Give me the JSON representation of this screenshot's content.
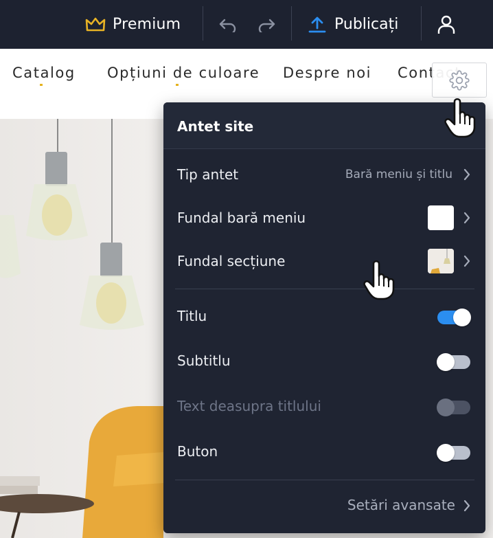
{
  "topbar": {
    "premium_label": "Premium",
    "publish_label": "Publicați",
    "icons": [
      "crown-icon",
      "undo-icon",
      "redo-icon",
      "upload-icon",
      "user-icon"
    ],
    "colors": {
      "background": "#1d2230",
      "crown": "#e8b325",
      "publish_icon": "#2b8ef0"
    }
  },
  "nav": {
    "items": [
      "Catalog",
      "Opțiuni de culoare",
      "Despre noi",
      "Contact"
    ],
    "settings_icon": "gear-icon"
  },
  "panel": {
    "title": "Antet site",
    "rows": {
      "header_type": {
        "label": "Tip antet",
        "value": "Bară meniu și titlu"
      },
      "menu_bg": {
        "label": "Fundal bară meniu",
        "swatch_color": "#ffffff"
      },
      "section_bg": {
        "label": "Fundal secțiune"
      }
    },
    "toggles": [
      {
        "label": "Titlu",
        "on": true,
        "disabled": false
      },
      {
        "label": "Subtitlu",
        "on": false,
        "disabled": false
      },
      {
        "label": "Text deasupra titlului",
        "on": false,
        "disabled": true
      },
      {
        "label": "Buton",
        "on": false,
        "disabled": false
      }
    ],
    "advanced_label": "Setări avansate",
    "colors": {
      "background": "#1f2432",
      "toggle_on": "#2b8ef0"
    }
  }
}
